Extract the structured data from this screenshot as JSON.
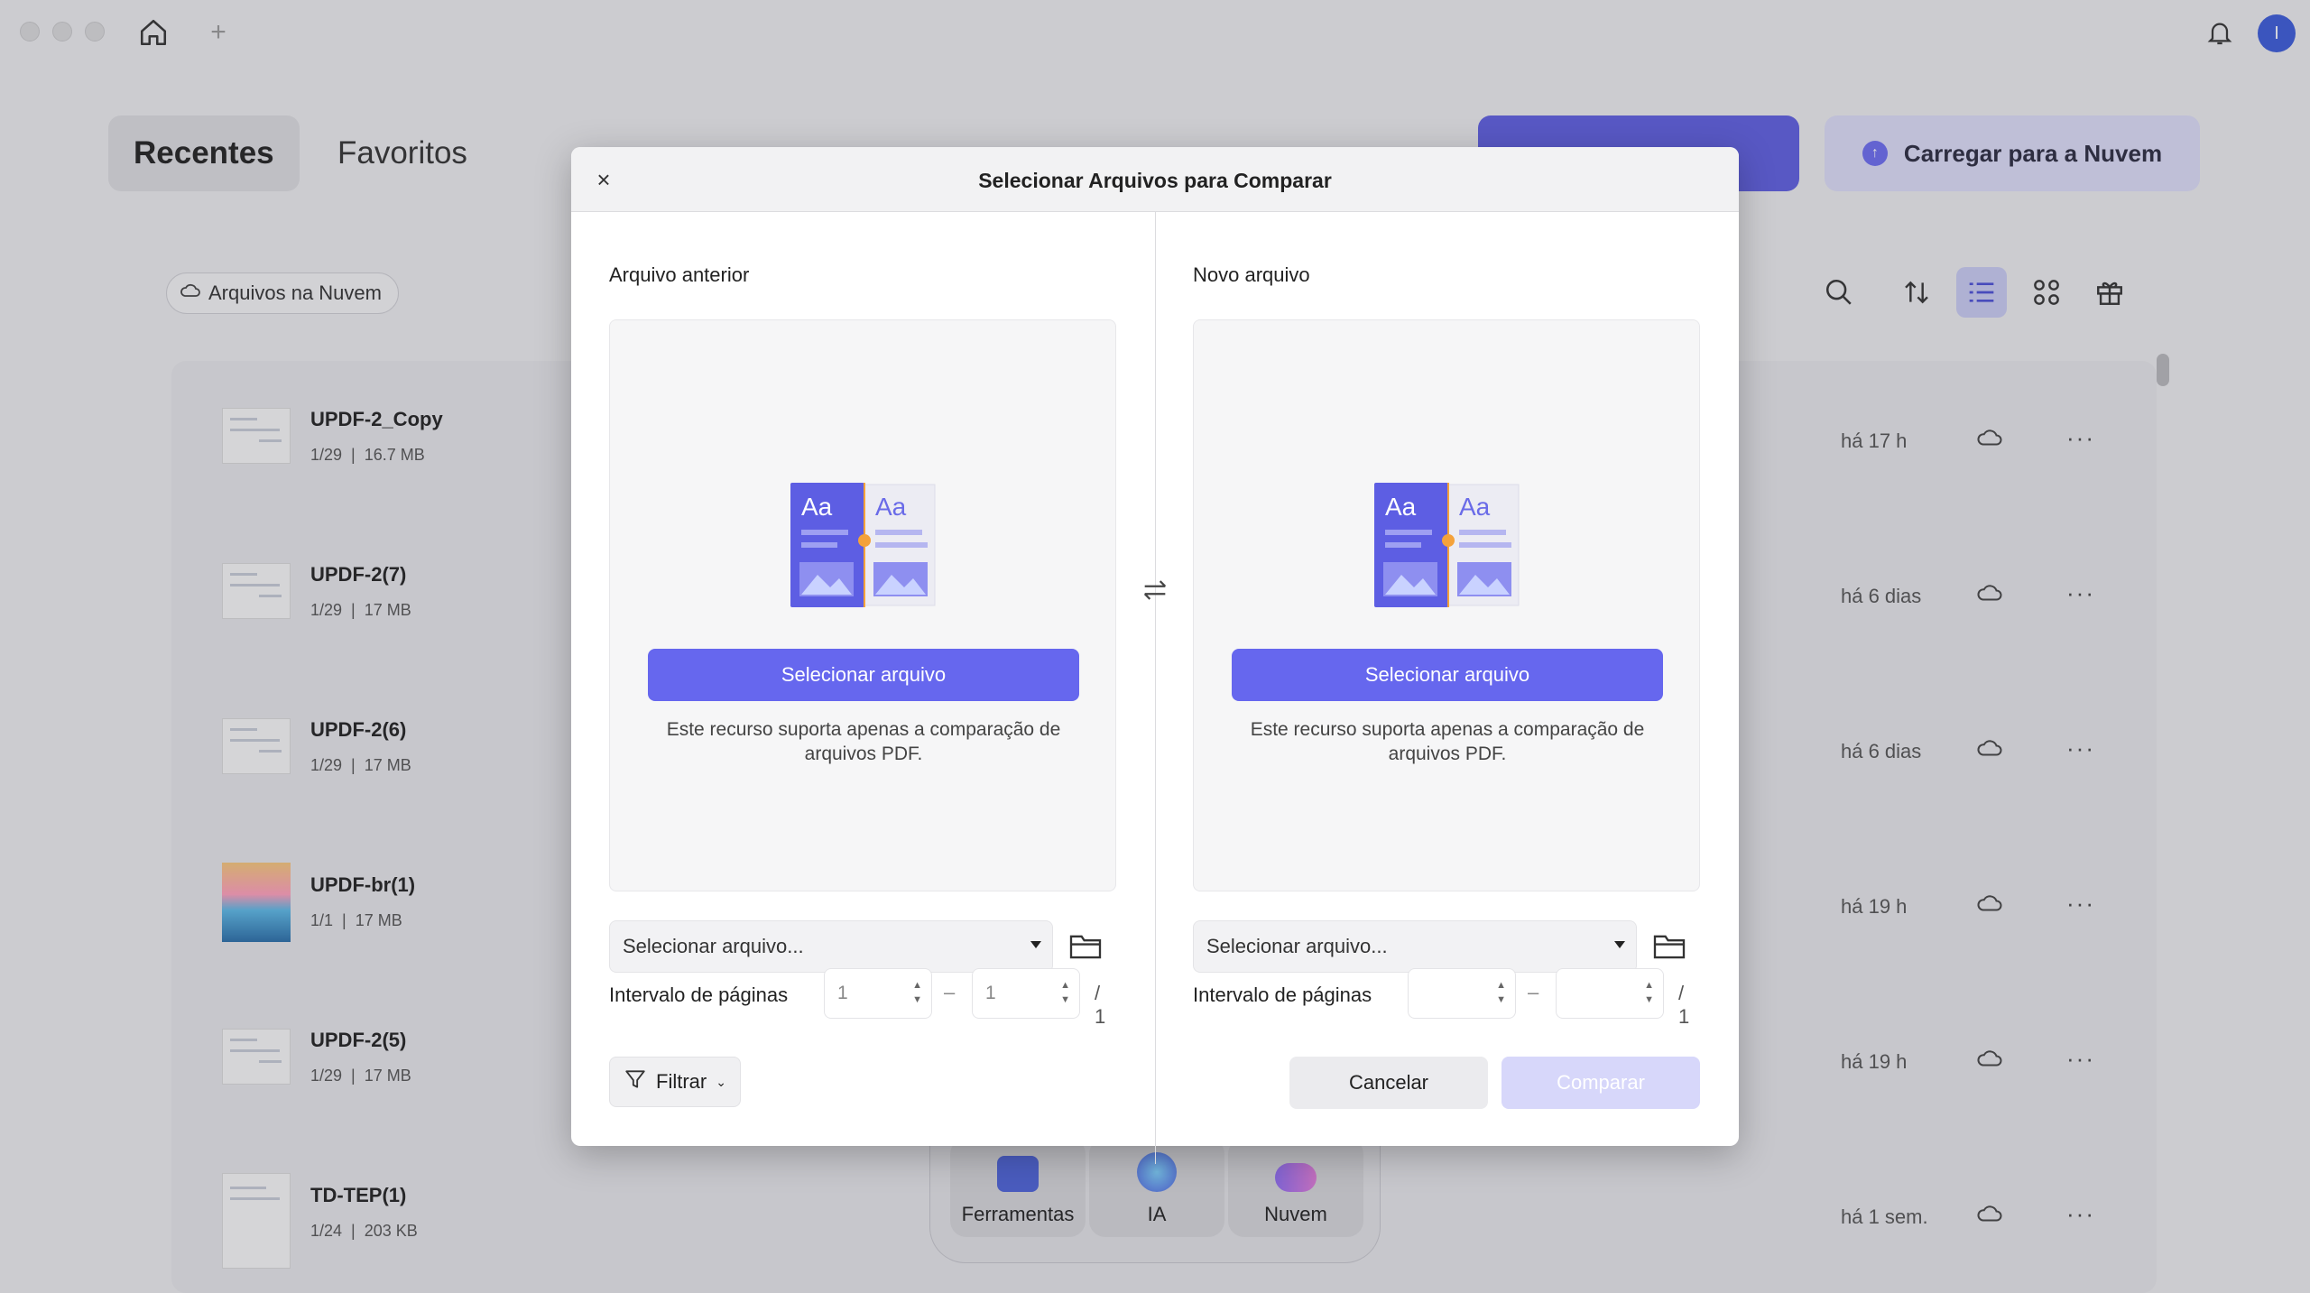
{
  "tabs": [
    {
      "label": "Recentes",
      "active": true
    },
    {
      "label": "Favoritos",
      "active": false
    }
  ],
  "header_actions": {
    "cloud_upload_label": "Carregar para a Nuvem",
    "accent": "#5e5fe0"
  },
  "filter_chip": {
    "label": "Arquivos na Nuvem"
  },
  "avatar": {
    "initial": "I"
  },
  "files": [
    {
      "name": "UPDF-2_Copy",
      "pages": "1/29",
      "size": "16.7 MB",
      "time": "há 17 h"
    },
    {
      "name": "UPDF-2(7)",
      "pages": "1/29",
      "size": "17 MB",
      "time": "há 6 dias"
    },
    {
      "name": "UPDF-2(6)",
      "pages": "1/29",
      "size": "17 MB",
      "time": "há 6 dias"
    },
    {
      "name": "UPDF-br(1)",
      "pages": "1/1",
      "size": "17 MB",
      "time": "há 19 h"
    },
    {
      "name": "UPDF-2(5)",
      "pages": "1/29",
      "size": "17 MB",
      "time": "há 19 h"
    },
    {
      "name": "TD-TEP(1)",
      "pages": "1/24",
      "size": "203 KB",
      "time": "há 1 sem."
    }
  ],
  "dock": [
    {
      "label": "Ferramentas"
    },
    {
      "label": "IA"
    },
    {
      "label": "Nuvem"
    }
  ],
  "modal": {
    "title": "Selecionar Arquivos para Comparar",
    "left": {
      "label": "Arquivo anterior",
      "select_button": "Selecionar arquivo",
      "hint": "Este recurso suporta apenas a comparação de arquivos PDF.",
      "dropdown": "Selecionar arquivo...",
      "range_label": "Intervalo de páginas",
      "range_from": "1",
      "range_to": "1",
      "total": "/ 1"
    },
    "right": {
      "label": "Novo arquivo",
      "select_button": "Selecionar arquivo",
      "hint": "Este recurso suporta apenas a comparação de arquivos PDF.",
      "dropdown": "Selecionar arquivo...",
      "range_label": "Intervalo de páginas",
      "range_from": "",
      "range_to": "",
      "total": "/ 1"
    },
    "filter_label": "Filtrar",
    "cancel_label": "Cancelar",
    "compare_label": "Comparar",
    "button_color": "#6667ee"
  }
}
